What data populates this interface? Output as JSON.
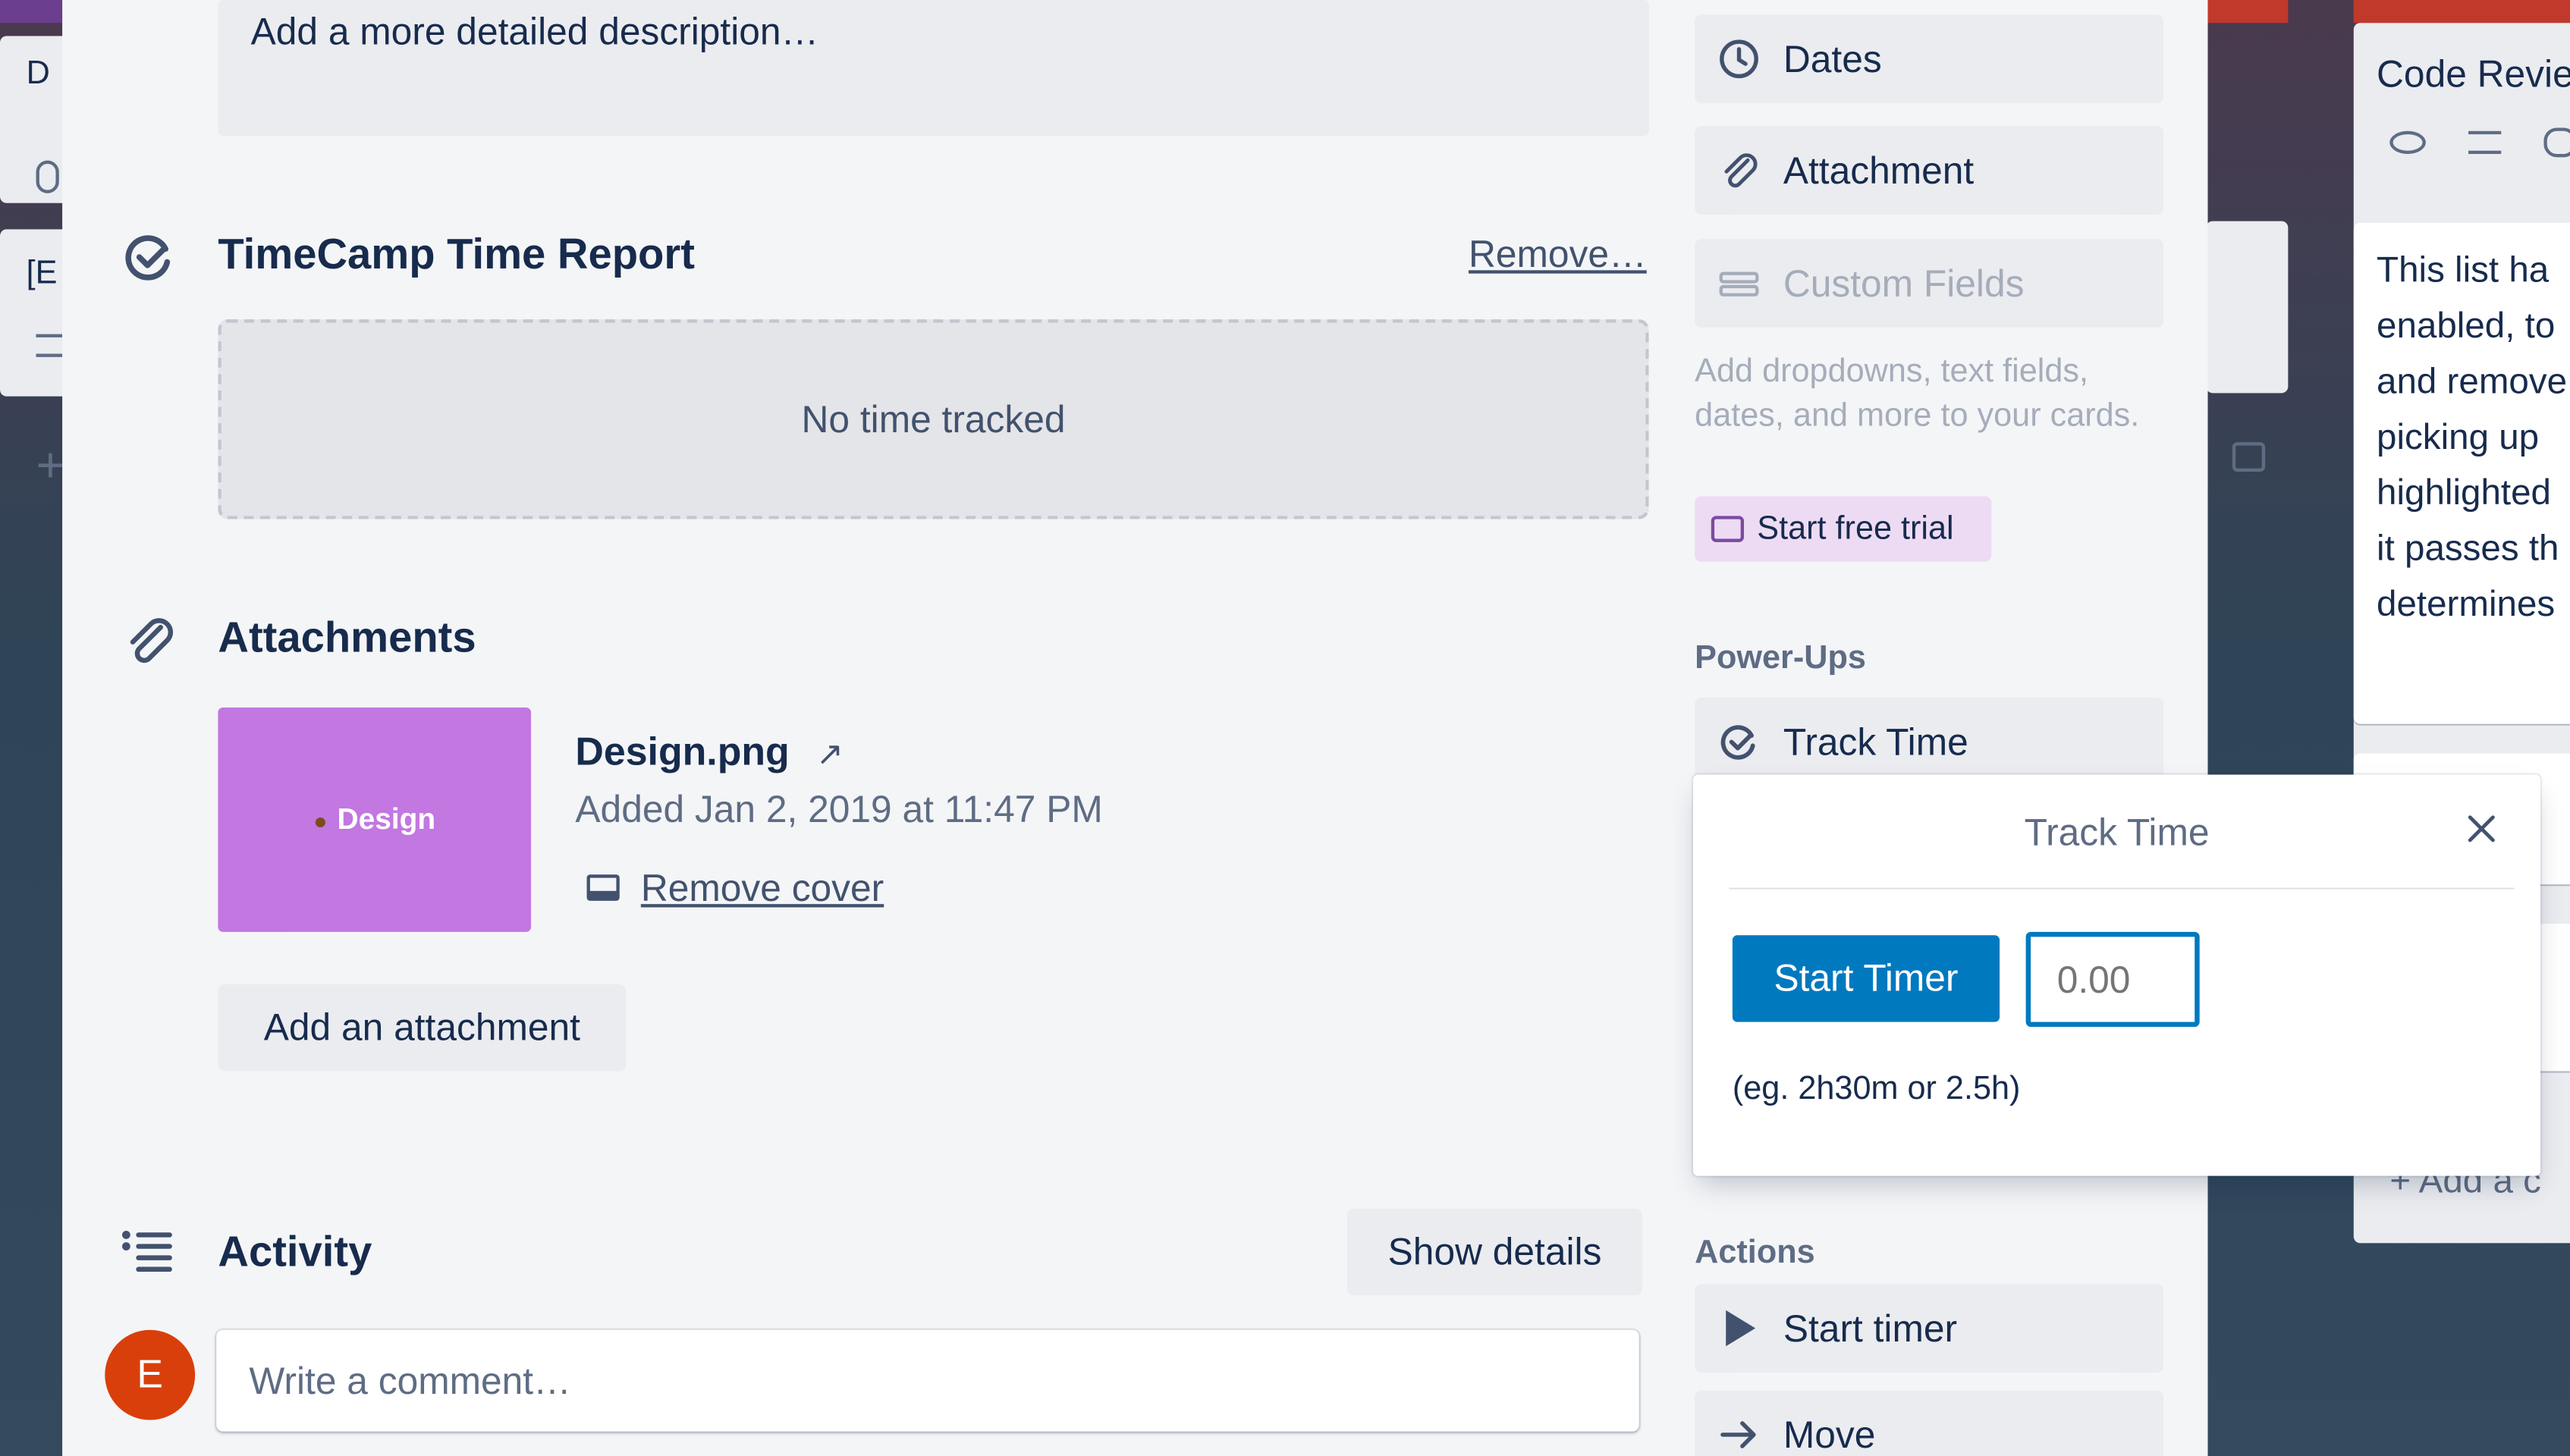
{
  "left_board": {
    "card1_text": "D",
    "card2_text": "[E"
  },
  "right_board": {
    "list_title": "Code Revie",
    "description_lines": [
      "This list ha",
      "enabled, to",
      "and remove",
      "picking up",
      "highlighted",
      "it passes th",
      "determines"
    ],
    "add_card_label": "+ Add a c"
  },
  "card": {
    "description_placeholder": "Add a more detailed description…",
    "timecamp": {
      "title": "TimeCamp Time Report",
      "remove_label": "Remove…",
      "empty_text": "No time tracked"
    },
    "attachments": {
      "title": "Attachments",
      "thumbnail_label": "Design",
      "thumbnail_color": "#c377e0",
      "file_name": "Design.png",
      "added_text": "Added Jan 2, 2019 at 11:47 PM",
      "remove_cover_label": "Remove cover",
      "add_attachment_label": "Add an attachment"
    },
    "activity": {
      "title": "Activity",
      "show_details_label": "Show details",
      "avatar_initial": "E",
      "avatar_color": "#d93f0b",
      "comment_placeholder": "Write a comment…"
    }
  },
  "sidebar": {
    "dates_label": "Dates",
    "attachment_label": "Attachment",
    "custom_fields_label": "Custom Fields",
    "custom_fields_description": "Add dropdowns, text fields, dates, and more to your cards.",
    "start_trial_label": "Start free trial",
    "powerups_heading": "Power-Ups",
    "track_time_label": "Track Time",
    "actions_heading": "Actions",
    "start_timer_label": "Start timer",
    "move_label": "Move"
  },
  "popover": {
    "title": "Track Time",
    "start_timer_label": "Start Timer",
    "time_input_placeholder": "0.00",
    "hint": "(eg. 2h30m or 2.5h)",
    "accent_color": "#0079bf"
  }
}
